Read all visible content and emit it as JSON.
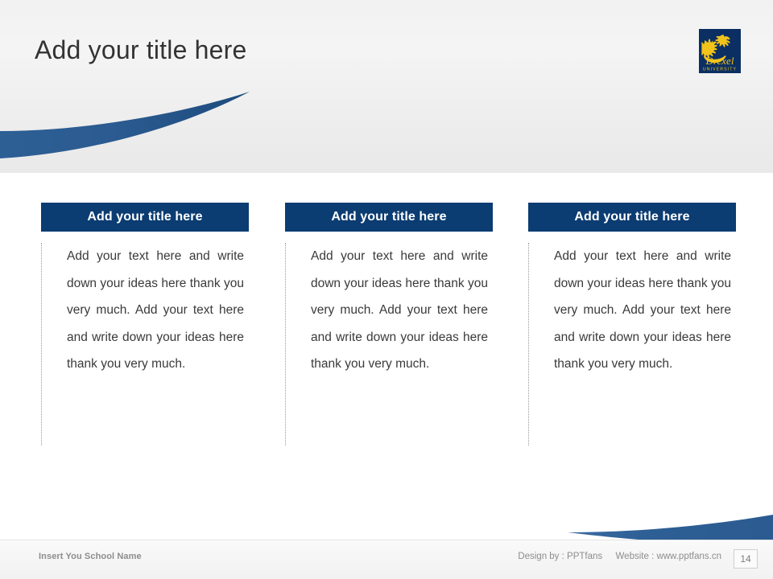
{
  "slide": {
    "title": "Add your title here",
    "accent_color": "#0b3c72",
    "logo_gold": "#f2c41a",
    "background_top": "#f1f1f1",
    "background_bottom": "#ffffff"
  },
  "logo": {
    "name": "Drexel",
    "subtitle": "UNIVERSITY",
    "icon": "dragon-icon"
  },
  "cards": [
    {
      "header": "Add your title here",
      "text": "Add your text here and write down your ideas here thank you very much. Add your text here and write down your ideas here thank you very much."
    },
    {
      "header": "Add your title here",
      "text": "Add your text here and write down your ideas here thank you very much. Add your text here and write down your ideas here thank you very much."
    },
    {
      "header": "Add your title here",
      "text": "Add your text here and write down your ideas here thank you very much. Add your text here and write down your ideas here thank you very much."
    }
  ],
  "footer": {
    "school_name": "Insert You School Name",
    "design_by": "Design by : PPTfans",
    "website": "Website : www.pptfans.cn",
    "page_number": "14"
  }
}
